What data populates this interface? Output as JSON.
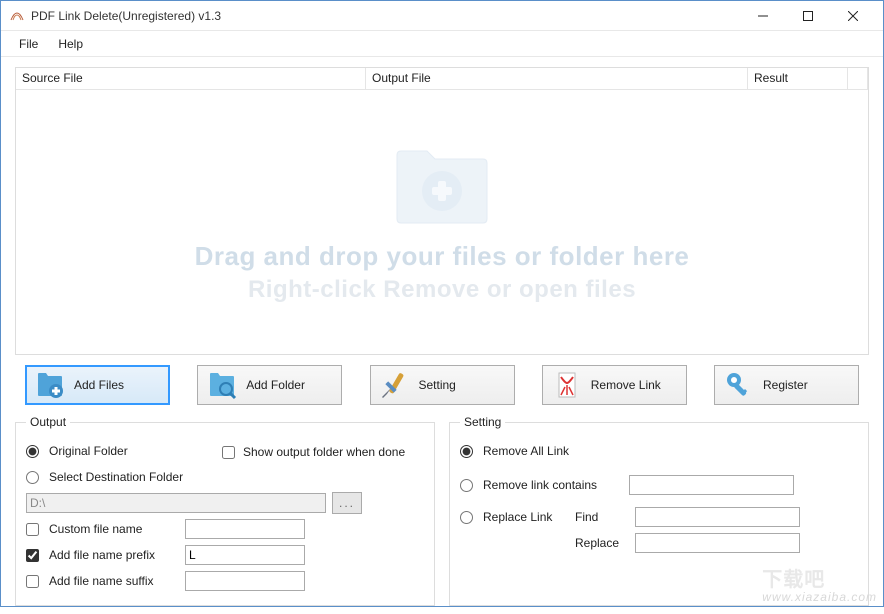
{
  "window": {
    "title": "PDF Link Delete(Unregistered) v1.3"
  },
  "menu": {
    "file": "File",
    "help": "Help"
  },
  "filelist": {
    "col_source": "Source File",
    "col_output": "Output File",
    "col_result": "Result",
    "hint_line1": "Drag and drop your files or folder here",
    "hint_line2": "Right-click Remove or open files"
  },
  "buttons": {
    "add_files": "Add Files",
    "add_folder": "Add Folder",
    "setting": "Setting",
    "remove_link": "Remove Link",
    "register": "Register"
  },
  "output": {
    "legend": "Output",
    "original_folder": "Original Folder",
    "select_destination": "Select Destination Folder",
    "show_done": "Show output folder when done",
    "dest_path": "D:\\",
    "browse": "...",
    "custom_file_name": "Custom file name",
    "custom_file_name_value": "",
    "add_prefix": "Add file name prefix",
    "prefix_value": "L",
    "add_suffix": "Add file name suffix",
    "suffix_value": ""
  },
  "setting": {
    "legend": "Setting",
    "remove_all": "Remove All Link",
    "remove_contains": "Remove link contains",
    "remove_contains_value": "",
    "replace_link": "Replace Link",
    "find_label": "Find",
    "find_value": "",
    "replace_label": "Replace",
    "replace_value": ""
  },
  "watermark": {
    "cn": "下载吧",
    "url": "www.xiazaiba.com"
  }
}
